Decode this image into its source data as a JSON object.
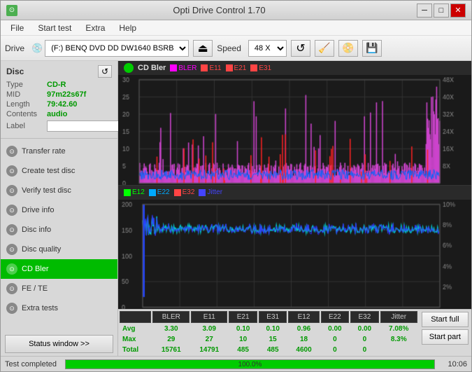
{
  "window": {
    "title": "Opti Drive Control 1.70",
    "icon": "⊙"
  },
  "titlebar": {
    "minimize": "─",
    "maximize": "□",
    "close": "✕"
  },
  "menu": {
    "items": [
      "File",
      "Start test",
      "Extra",
      "Help"
    ]
  },
  "toolbar": {
    "drive_label": "Drive",
    "drive_value": "(F:)  BENQ DVD DD DW1640 BSRB",
    "speed_label": "Speed",
    "speed_value": "48 X"
  },
  "disc": {
    "header": "Disc",
    "type_label": "Type",
    "type_value": "CD-R",
    "mid_label": "MID",
    "mid_value": "97m22s67f",
    "length_label": "Length",
    "length_value": "79:42.60",
    "contents_label": "Contents",
    "contents_value": "audio",
    "label_label": "Label",
    "label_placeholder": ""
  },
  "nav": {
    "items": [
      {
        "id": "transfer-rate",
        "label": "Transfer rate",
        "active": false
      },
      {
        "id": "create-test-disc",
        "label": "Create test disc",
        "active": false
      },
      {
        "id": "verify-test-disc",
        "label": "Verify test disc",
        "active": false
      },
      {
        "id": "drive-info",
        "label": "Drive info",
        "active": false
      },
      {
        "id": "disc-info",
        "label": "Disc info",
        "active": false
      },
      {
        "id": "disc-quality",
        "label": "Disc quality",
        "active": false
      },
      {
        "id": "cd-bler",
        "label": "CD Bler",
        "active": true
      },
      {
        "id": "fe-te",
        "label": "FE / TE",
        "active": false
      },
      {
        "id": "extra-tests",
        "label": "Extra tests",
        "active": false
      }
    ],
    "status_window": "Status window >>"
  },
  "chart1": {
    "title": "CD Bler",
    "legend": [
      {
        "label": "BLER",
        "color": "#ff00ff"
      },
      {
        "label": "E11",
        "color": "#ff0000"
      },
      {
        "label": "E21",
        "color": "#ff0000"
      },
      {
        "label": "E31",
        "color": "#ff0000"
      }
    ],
    "y_max": 30,
    "x_max": 80,
    "y_right_labels": [
      "8X",
      "16X",
      "24X",
      "32X",
      "40X",
      "48X"
    ]
  },
  "chart2": {
    "legend": [
      {
        "label": "E12",
        "color": "#00ff00"
      },
      {
        "label": "E22",
        "color": "#00aaff"
      },
      {
        "label": "E32",
        "color": "#ff0000"
      },
      {
        "label": "Jitter",
        "color": "#0000ff"
      }
    ],
    "y_max": 200,
    "x_max": 80,
    "y_right_percent": [
      "2%",
      "4%",
      "6%",
      "8%",
      "10%"
    ]
  },
  "table": {
    "headers": [
      "",
      "BLER",
      "E11",
      "E21",
      "E31",
      "E12",
      "E22",
      "E32",
      "Jitter"
    ],
    "rows": [
      {
        "label": "Avg",
        "values": [
          "3.30",
          "3.09",
          "0.10",
          "0.10",
          "0.96",
          "0.00",
          "0.00",
          "7.08%"
        ]
      },
      {
        "label": "Max",
        "values": [
          "29",
          "27",
          "10",
          "15",
          "18",
          "0",
          "0",
          "8.3%"
        ]
      },
      {
        "label": "Total",
        "values": [
          "15761",
          "14791",
          "485",
          "485",
          "4600",
          "0",
          "0",
          ""
        ]
      }
    ]
  },
  "buttons": {
    "start_full": "Start full",
    "start_part": "Start part"
  },
  "statusbar": {
    "text": "Test completed",
    "progress": 100.0,
    "progress_text": "100.0%",
    "time": "10:06"
  }
}
